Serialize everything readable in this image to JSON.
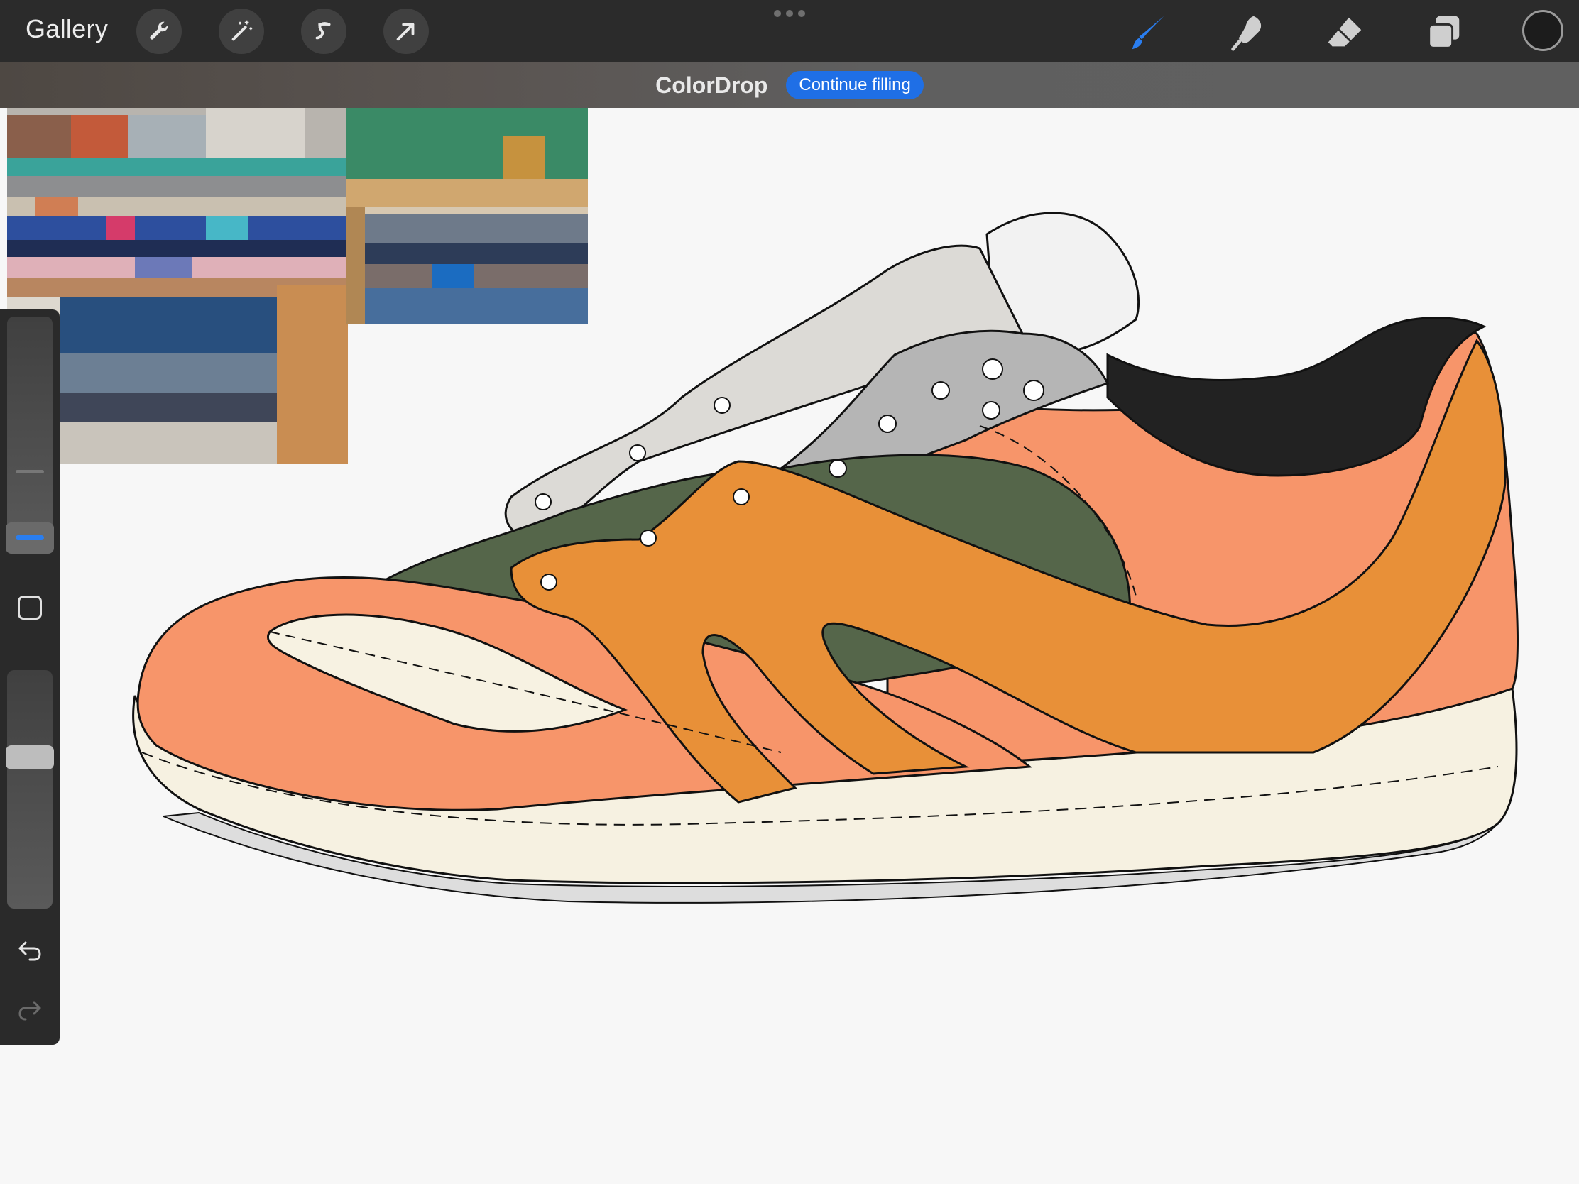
{
  "toolbar": {
    "gallery_label": "Gallery",
    "left_tools": [
      "wrench-icon",
      "magic-wand-icon",
      "selection-s-icon",
      "transform-arrow-icon"
    ],
    "right_tools": [
      "brush-icon",
      "smudge-icon",
      "eraser-icon",
      "layers-icon"
    ],
    "active_tool": "brush",
    "current_color": "#1c1c1c",
    "accent_color": "#2a7ef0"
  },
  "notification": {
    "title": "ColorDrop",
    "action_label": "Continue filling"
  },
  "sidebar": {
    "brush_size_label": "",
    "opacity_label": "",
    "buttons": [
      "modify-square-icon",
      "undo-icon",
      "redo-icon"
    ]
  },
  "canvas": {
    "reference_images": [
      "folded-blankets-photo-1",
      "folded-blankets-photo-2"
    ],
    "artwork": "sneaker-line-art",
    "palette": {
      "salmon": "#f7956a",
      "orange": "#e89038",
      "green": "#55664a",
      "gray": "#b5b5b5",
      "cream": "#f7f2e2",
      "black": "#222222"
    }
  }
}
